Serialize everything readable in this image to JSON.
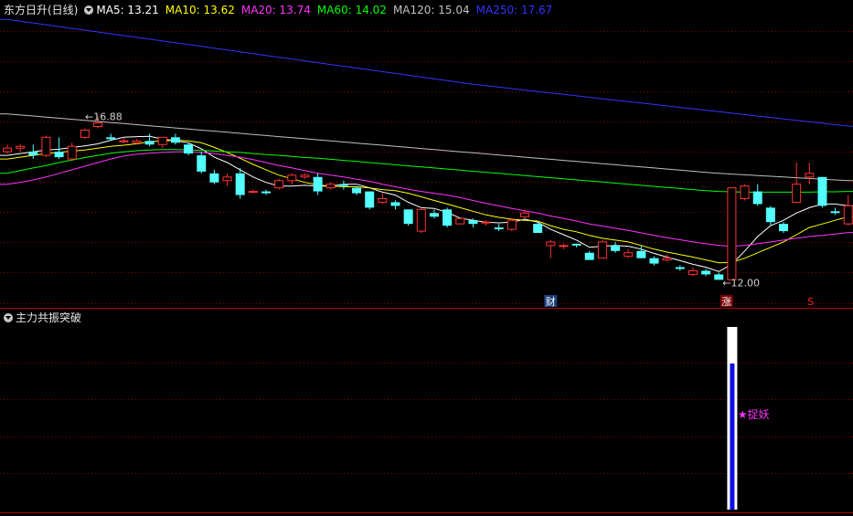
{
  "header": {
    "stock_title": "东方日升(日线)",
    "ma_items": [
      {
        "label": "MA5: 13.21",
        "color": "#ffffff"
      },
      {
        "label": "MA10: 13.62",
        "color": "#ffff00"
      },
      {
        "label": "MA20: 13.74",
        "color": "#ff33ff"
      },
      {
        "label": "MA60: 14.02",
        "color": "#00ff00"
      },
      {
        "label": "MA120: 15.04",
        "color": "#c0c0c0"
      },
      {
        "label": "MA250: 17.67",
        "color": "#3333ff"
      }
    ]
  },
  "indicator": {
    "title": "主力共振突破",
    "signal_label": "★捉妖",
    "signal_color": "#ff33ff"
  },
  "annotations": {
    "high_label": "16.88",
    "low_label": "12.00",
    "finance_marker": "财",
    "limit_up_marker": "涨",
    "s_marker": "S"
  },
  "colors": {
    "up": "#ff3232",
    "down": "#54ffff",
    "grid": "#8b0000",
    "border": "#b00000"
  },
  "chart_data": {
    "type": "candlestick",
    "ylim": [
      11.6,
      19.6
    ],
    "ohlc": [
      [
        15.9,
        16.1,
        15.85,
        16.0
      ],
      [
        16.0,
        16.1,
        15.9,
        16.05
      ],
      [
        15.9,
        16.1,
        15.7,
        15.8
      ],
      [
        15.8,
        16.35,
        15.75,
        16.3
      ],
      [
        15.9,
        16.3,
        15.7,
        15.75
      ],
      [
        15.7,
        16.15,
        15.65,
        16.05
      ],
      [
        16.3,
        16.55,
        16.25,
        16.5
      ],
      [
        16.6,
        16.88,
        16.55,
        16.7
      ],
      [
        16.3,
        16.4,
        16.2,
        16.25
      ],
      [
        16.2,
        16.3,
        16.15,
        16.2
      ],
      [
        16.15,
        16.25,
        16.1,
        16.2
      ],
      [
        16.2,
        16.4,
        16.05,
        16.1
      ],
      [
        16.1,
        16.3,
        16.0,
        16.3
      ],
      [
        16.3,
        16.4,
        16.1,
        16.15
      ],
      [
        16.1,
        16.15,
        15.8,
        15.85
      ],
      [
        15.8,
        15.9,
        15.3,
        15.35
      ],
      [
        15.3,
        15.4,
        15.0,
        15.05
      ],
      [
        15.1,
        15.3,
        14.95,
        15.2
      ],
      [
        15.3,
        15.45,
        14.6,
        14.7
      ],
      [
        14.8,
        14.85,
        14.75,
        14.8
      ],
      [
        14.8,
        14.85,
        14.7,
        14.75
      ],
      [
        14.9,
        15.15,
        14.85,
        15.1
      ],
      [
        15.1,
        15.3,
        15.0,
        15.25
      ],
      [
        15.2,
        15.3,
        15.15,
        15.25
      ],
      [
        15.2,
        15.3,
        14.7,
        14.8
      ],
      [
        14.9,
        15.05,
        14.85,
        15.0
      ],
      [
        15.0,
        15.1,
        14.85,
        14.95
      ],
      [
        14.9,
        14.95,
        14.7,
        14.75
      ],
      [
        14.8,
        14.8,
        14.3,
        14.35
      ],
      [
        14.5,
        14.75,
        14.45,
        14.6
      ],
      [
        14.5,
        14.55,
        14.3,
        14.4
      ],
      [
        14.3,
        14.3,
        13.85,
        13.9
      ],
      [
        13.7,
        14.35,
        13.65,
        14.3
      ],
      [
        14.2,
        14.3,
        14.05,
        14.1
      ],
      [
        14.3,
        14.35,
        13.8,
        13.85
      ],
      [
        13.9,
        14.05,
        13.9,
        14.05
      ],
      [
        14.0,
        14.05,
        13.8,
        13.9
      ],
      [
        13.95,
        14.0,
        13.85,
        13.95
      ],
      [
        13.8,
        13.9,
        13.7,
        13.75
      ],
      [
        13.75,
        14.05,
        13.7,
        14.0
      ],
      [
        14.1,
        14.3,
        14.05,
        14.2
      ],
      [
        13.9,
        13.95,
        13.65,
        13.65
      ],
      [
        13.3,
        13.45,
        12.95,
        13.4
      ],
      [
        13.3,
        13.35,
        13.2,
        13.3
      ],
      [
        13.35,
        13.35,
        13.25,
        13.3
      ],
      [
        13.1,
        13.15,
        12.9,
        12.9
      ],
      [
        12.95,
        13.45,
        12.95,
        13.4
      ],
      [
        13.3,
        13.4,
        13.1,
        13.15
      ],
      [
        13.0,
        13.2,
        12.95,
        13.1
      ],
      [
        13.15,
        13.3,
        12.95,
        12.95
      ],
      [
        12.95,
        13.0,
        12.75,
        12.8
      ],
      [
        12.9,
        13.05,
        12.85,
        12.95
      ],
      [
        12.7,
        12.75,
        12.6,
        12.65
      ],
      [
        12.5,
        12.7,
        12.45,
        12.6
      ],
      [
        12.6,
        12.65,
        12.45,
        12.5
      ],
      [
        12.5,
        12.55,
        12.35,
        12.35
      ],
      [
        12.35,
        14.9,
        12.35,
        14.9
      ],
      [
        14.6,
        15.0,
        14.55,
        14.95
      ],
      [
        14.8,
        15.0,
        14.4,
        14.45
      ],
      [
        14.35,
        14.4,
        13.85,
        13.95
      ],
      [
        13.9,
        13.95,
        13.65,
        13.7
      ],
      [
        14.5,
        15.6,
        14.5,
        15.0
      ],
      [
        15.2,
        15.6,
        15.0,
        15.3
      ],
      [
        15.2,
        15.2,
        14.35,
        14.4
      ],
      [
        14.25,
        14.35,
        14.15,
        14.2
      ],
      [
        13.9,
        14.7,
        13.85,
        14.4
      ]
    ],
    "ma_series": [
      {
        "name": "MA5",
        "color": "#ffffff",
        "values": [
          15.8,
          15.85,
          15.9,
          15.95,
          15.97,
          16.02,
          16.06,
          16.12,
          16.22,
          16.3,
          16.32,
          16.33,
          16.25,
          16.2,
          16.15,
          15.98,
          15.75,
          15.6,
          15.4,
          15.2,
          15.05,
          14.95,
          14.95,
          14.97,
          14.95,
          14.95,
          15.0,
          15.0,
          14.9,
          14.78,
          14.7,
          14.5,
          14.35,
          14.33,
          14.22,
          14.06,
          14.0,
          13.95,
          13.93,
          13.95,
          14.03,
          13.95,
          13.75,
          13.6,
          13.45,
          13.25,
          13.28,
          13.3,
          13.28,
          13.2,
          13.08,
          12.98,
          12.88,
          12.78,
          12.7,
          12.58,
          12.78,
          13.15,
          13.55,
          13.85,
          14.0,
          14.2,
          14.35,
          14.45,
          14.45,
          14.4
        ]
      },
      {
        "name": "MA10",
        "color": "#ffff00",
        "values": [
          15.7,
          15.75,
          15.8,
          15.85,
          15.88,
          15.92,
          15.95,
          16.0,
          16.05,
          16.08,
          16.12,
          16.18,
          16.2,
          16.22,
          16.2,
          16.15,
          16.02,
          15.88,
          15.72,
          15.55,
          15.4,
          15.25,
          15.15,
          15.05,
          14.98,
          14.95,
          14.93,
          14.93,
          14.9,
          14.85,
          14.82,
          14.75,
          14.65,
          14.55,
          14.45,
          14.35,
          14.25,
          14.15,
          14.08,
          14.03,
          14.0,
          13.98,
          13.85,
          13.75,
          13.68,
          13.58,
          13.5,
          13.45,
          13.4,
          13.3,
          13.2,
          13.12,
          13.05,
          12.98,
          12.9,
          12.82,
          12.83,
          12.95,
          13.1,
          13.25,
          13.4,
          13.6,
          13.8,
          13.9,
          14.0,
          14.1
        ]
      },
      {
        "name": "MA20",
        "color": "#ff33ff",
        "values": [
          15.0,
          15.05,
          15.12,
          15.2,
          15.3,
          15.4,
          15.5,
          15.6,
          15.7,
          15.78,
          15.83,
          15.86,
          15.88,
          15.9,
          15.9,
          15.88,
          15.85,
          15.8,
          15.75,
          15.68,
          15.6,
          15.52,
          15.45,
          15.38,
          15.3,
          15.25,
          15.2,
          15.14,
          15.08,
          15.0,
          14.93,
          14.86,
          14.8,
          14.75,
          14.7,
          14.63,
          14.55,
          14.47,
          14.4,
          14.33,
          14.26,
          14.2,
          14.12,
          14.05,
          13.98,
          13.9,
          13.84,
          13.78,
          13.72,
          13.65,
          13.58,
          13.52,
          13.46,
          13.4,
          13.35,
          13.3,
          13.28,
          13.3,
          13.35,
          13.4,
          13.45,
          13.5,
          13.55,
          13.58,
          13.62,
          13.66
        ]
      },
      {
        "name": "MA60",
        "color": "#00ff00",
        "values": [
          15.3,
          15.38,
          15.45,
          15.52,
          15.6,
          15.67,
          15.74,
          15.8,
          15.86,
          15.9,
          15.93,
          15.95,
          15.96,
          15.96,
          15.95,
          15.94,
          15.92,
          15.9,
          15.88,
          15.85,
          15.82,
          15.8,
          15.77,
          15.74,
          15.72,
          15.69,
          15.66,
          15.63,
          15.6,
          15.57,
          15.54,
          15.51,
          15.48,
          15.45,
          15.42,
          15.39,
          15.36,
          15.33,
          15.3,
          15.27,
          15.24,
          15.21,
          15.18,
          15.15,
          15.12,
          15.09,
          15.06,
          15.03,
          15.0,
          14.97,
          14.94,
          14.91,
          14.88,
          14.85,
          14.82,
          14.8,
          14.79,
          14.78,
          14.78,
          14.78,
          14.78,
          14.78,
          14.78,
          14.79,
          14.79,
          14.8
        ]
      },
      {
        "name": "MA120",
        "color": "#c0c0c0",
        "values": [
          16.95,
          16.92,
          16.89,
          16.86,
          16.83,
          16.8,
          16.77,
          16.74,
          16.71,
          16.68,
          16.65,
          16.62,
          16.59,
          16.56,
          16.53,
          16.5,
          16.47,
          16.44,
          16.41,
          16.38,
          16.35,
          16.32,
          16.29,
          16.26,
          16.23,
          16.2,
          16.17,
          16.14,
          16.11,
          16.08,
          16.05,
          16.02,
          15.99,
          15.96,
          15.93,
          15.9,
          15.87,
          15.84,
          15.81,
          15.78,
          15.75,
          15.72,
          15.69,
          15.66,
          15.63,
          15.6,
          15.57,
          15.54,
          15.51,
          15.48,
          15.45,
          15.42,
          15.39,
          15.36,
          15.33,
          15.3,
          15.28,
          15.26,
          15.24,
          15.22,
          15.2,
          15.18,
          15.16,
          15.14,
          15.12,
          15.1
        ]
      },
      {
        "name": "MA250",
        "color": "#3333ff",
        "values": [
          19.57,
          19.52,
          19.47,
          19.42,
          19.37,
          19.32,
          19.27,
          19.22,
          19.17,
          19.12,
          19.07,
          19.02,
          18.97,
          18.92,
          18.87,
          18.82,
          18.77,
          18.72,
          18.67,
          18.62,
          18.57,
          18.52,
          18.47,
          18.42,
          18.37,
          18.32,
          18.27,
          18.22,
          18.17,
          18.12,
          18.07,
          18.02,
          17.97,
          17.92,
          17.87,
          17.82,
          17.77,
          17.73,
          17.69,
          17.65,
          17.61,
          17.57,
          17.53,
          17.49,
          17.45,
          17.41,
          17.37,
          17.33,
          17.29,
          17.25,
          17.21,
          17.17,
          17.13,
          17.09,
          17.05,
          17.01,
          16.97,
          16.93,
          16.89,
          16.85,
          16.81,
          16.77,
          16.73,
          16.69,
          16.65,
          16.61
        ]
      }
    ],
    "indicator_signals": [
      {
        "index": 56,
        "label": "★捉妖"
      }
    ]
  }
}
